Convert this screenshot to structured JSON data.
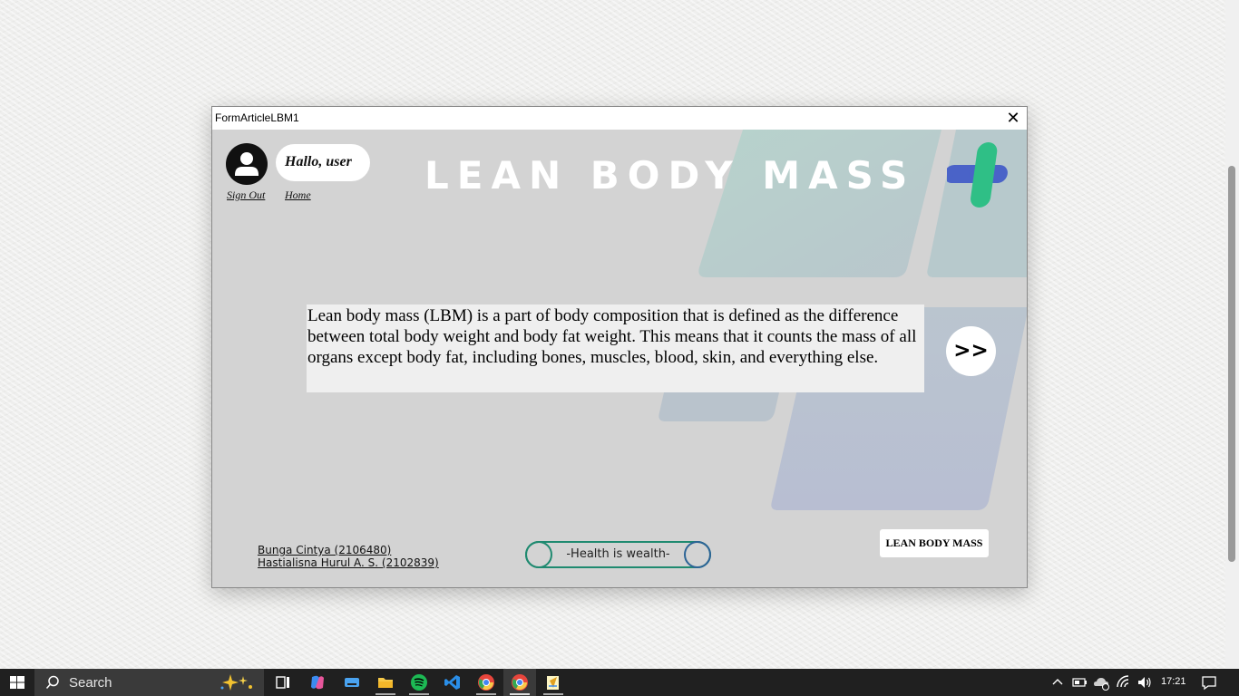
{
  "window": {
    "title": "FormArticleLBM1",
    "close_glyph": "✕"
  },
  "header": {
    "greeting": "Hallo, user",
    "sign_out": "Sign Out",
    "home": "Home",
    "page_title": "LEAN BODY MASS"
  },
  "article": {
    "body": "Lean body mass (LBM) is a part of body composition that is defined as the difference between total body weight and body fat weight. This means that it counts the mass of all organs except body fat, including bones, muscles, blood, skin, and everything else.",
    "next_label": ">>"
  },
  "footer": {
    "authors": [
      "Bunga Cintya (2106480)",
      "Hastialisna Hurul A. S. (2102839)"
    ],
    "motto": "-Health is wealth-",
    "lbm_button": "LEAN BODY MASS"
  },
  "taskbar": {
    "search_placeholder": "Search",
    "clock": "17:21",
    "apps": [
      "task-view",
      "copilot",
      "keyboard",
      "file-explorer",
      "spotify",
      "vscode",
      "chrome",
      "chrome-active",
      "notepad"
    ]
  },
  "colors": {
    "window_bg": "#d3d3d3",
    "accent_green": "#2fbf86",
    "accent_blue": "#4a63c8",
    "motto_border": "#1f8a70"
  }
}
